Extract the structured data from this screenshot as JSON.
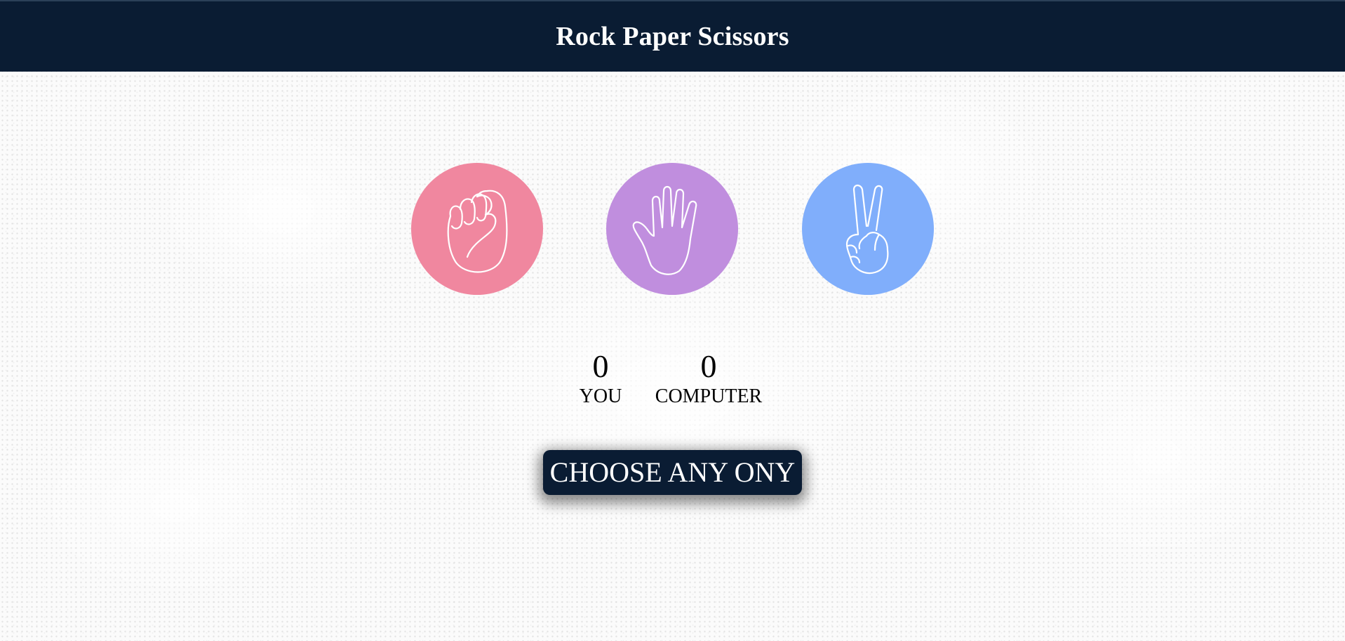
{
  "header": {
    "title": "Rock Paper Scissors",
    "background": "#0a1c33"
  },
  "choices": [
    {
      "id": "rock",
      "icon": "fist-icon",
      "color": "#f0879f"
    },
    {
      "id": "paper",
      "icon": "open-hand-icon",
      "color": "#c08ede"
    },
    {
      "id": "scissors",
      "icon": "peace-hand-icon",
      "color": "#80aefb"
    }
  ],
  "scoreboard": {
    "user": {
      "score": "0",
      "label": "YOU"
    },
    "computer": {
      "score": "0",
      "label": "COMPUTER"
    }
  },
  "message": {
    "text": "CHOOSE ANY ONY",
    "background": "#0a1c33"
  }
}
